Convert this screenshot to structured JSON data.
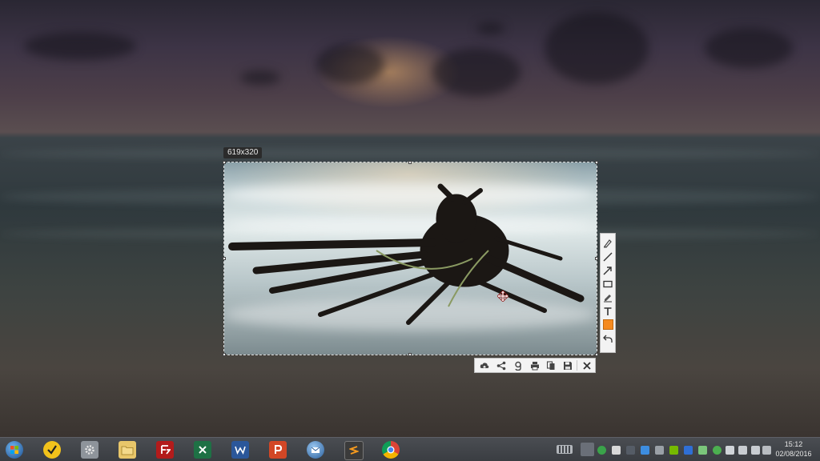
{
  "capture": {
    "size_label": "619x320"
  },
  "tools_vertical": [
    {
      "name": "marker-icon"
    },
    {
      "name": "line-icon"
    },
    {
      "name": "arrow-icon"
    },
    {
      "name": "rectangle-icon"
    },
    {
      "name": "pencil-icon"
    },
    {
      "name": "text-icon"
    },
    {
      "name": "color-swatch",
      "color": "#f58a1f"
    },
    {
      "name": "undo-icon"
    }
  ],
  "tools_horizontal": [
    {
      "name": "upload-cloud-icon"
    },
    {
      "name": "share-icon"
    },
    {
      "name": "google-search-icon"
    },
    {
      "name": "print-icon"
    },
    {
      "name": "copy-icon"
    },
    {
      "name": "save-icon"
    },
    {
      "name": "close-icon"
    }
  ],
  "taskbar": {
    "apps": [
      "start-orb-icon",
      "norton-icon",
      "settings-app-icon",
      "file-explorer-icon",
      "filezilla-icon",
      "excel-icon",
      "word-icon",
      "powerpoint-icon",
      "thunderbird-icon",
      "sublime-text-icon",
      "chrome-icon"
    ],
    "clock": {
      "time": "15:12",
      "date": "02/08/2016"
    }
  }
}
